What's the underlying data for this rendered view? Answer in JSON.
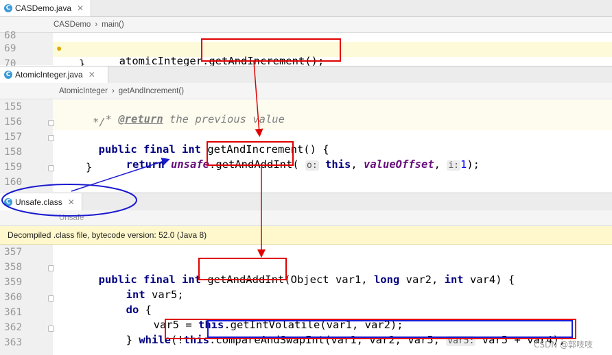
{
  "editor1": {
    "tab": "CASDemo.java",
    "breadcrumb": [
      "CASDemo",
      "main()"
    ],
    "lines": [
      "68",
      "69",
      "70"
    ],
    "code": [
      "atomicInteger.",
      "getAndIncrement();"
    ]
  },
  "editor2": {
    "tab": "AtomicInteger.java",
    "breadcrumb": [
      "AtomicInteger",
      "getAndIncrement()"
    ],
    "lines": [
      "155",
      "156",
      "157",
      "158",
      "159",
      "160"
    ],
    "comment1_star": "* ",
    "comment1_tag": "@return",
    "comment1_text": " the previous value",
    "comment2": "*/",
    "l157_mods": "public final int ",
    "l157_rest": "getAndIncrement() {",
    "l158_kw": "return ",
    "l158_unsafe": "unsafe",
    "l158_dot": ".",
    "l158_method": "getAndAddInt",
    "l158_paren": "(",
    "l158_hint_o": "o:",
    "l158_this": "this",
    "l158_comma": ", ",
    "l158_field": "valueOffset",
    "l158_comma2": ", ",
    "l158_hint_i": "i:",
    "l158_one": "1",
    "l158_end": ");",
    "l159": "}"
  },
  "editor3": {
    "tab": "Unsafe.class",
    "breadcrumb": "Unsafe",
    "banner": "Decompiled .class file, bytecode version: 52.0 (Java 8)",
    "lines": [
      "357",
      "358",
      "359",
      "360",
      "361",
      "362",
      "363"
    ],
    "l358_mods": "public final int ",
    "l358_method": "getAndAddInt",
    "l358_p1": "(Object var1, ",
    "l358_long": "long",
    "l358_p2": " var2, ",
    "l358_int": "int",
    "l358_p3": " var4) {",
    "l359_int": "int",
    "l359_rest": " var5;",
    "l360_do": "do",
    "l360_rest": " {",
    "l361_a": "var5 = ",
    "l361_this": "this",
    "l361_b": ".getIntVolatile(var1, var2);",
    "l362_a": "} ",
    "l362_while": "while",
    "l362_b": "(",
    "l362_not": "!",
    "l362_this": "this",
    "l362_dot": ".",
    "l362_cas": "compareAndSwapInt(var1, var2, var5, ",
    "l362_hint": "var5:",
    "l362_c": " var5 + var4",
    "l362_end": ");"
  },
  "watermark": "CSDN @郭吱吱"
}
